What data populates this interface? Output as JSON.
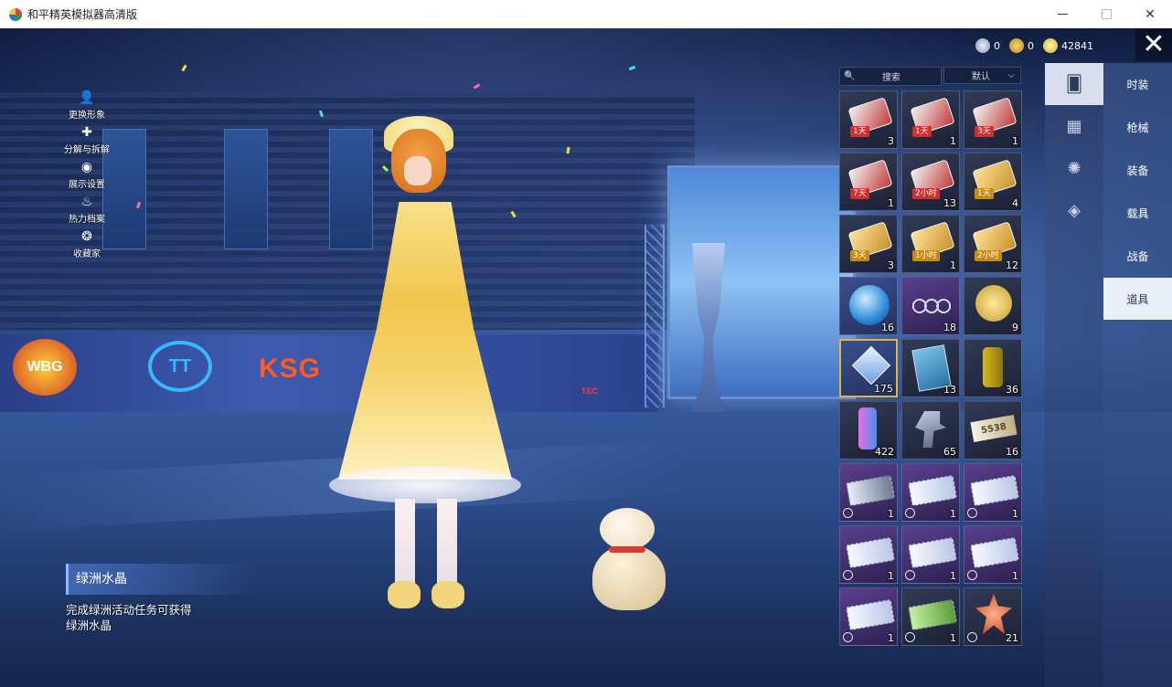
{
  "window": {
    "title": "和平精英模拟器高清版",
    "close_glyph": "✕",
    "max_glyph": "☐"
  },
  "currency": [
    {
      "icon": "silver-coin-icon",
      "value": "0"
    },
    {
      "icon": "gold-coin-icon",
      "value": "0"
    },
    {
      "icon": "bp-coin-icon",
      "value": "42841"
    }
  ],
  "close_glyph": "✕",
  "left_menu": [
    {
      "icon": "person-icon",
      "glyph": "👤",
      "label": "更换形象"
    },
    {
      "icon": "puzzle-icon",
      "glyph": "✚",
      "label": "分解与拆解"
    },
    {
      "icon": "eye-icon",
      "glyph": "◉",
      "label": "展示设置"
    },
    {
      "icon": "flame-icon",
      "glyph": "♨",
      "label": "热力档案"
    },
    {
      "icon": "collector-icon",
      "glyph": "❂",
      "label": "收藏家"
    }
  ],
  "logos": [
    "WBG",
    "TT",
    "KSG",
    "TEC"
  ],
  "item_detail": {
    "name": "绿洲水晶",
    "description": "完成绿洲活动任务可获得绿洲水晶"
  },
  "inventory": {
    "search_placeholder": "搜索",
    "search_icon_glyph": "🔍",
    "sort_label": "默认",
    "sort_arrow": "⌵",
    "items": [
      {
        "icon": "card-icon",
        "style": "red",
        "tier": "dark",
        "tag": "1天",
        "qty": "3",
        "clock": false
      },
      {
        "icon": "card-icon",
        "style": "red",
        "tier": "dark",
        "tag": "1天",
        "qty": "1",
        "clock": false
      },
      {
        "icon": "card-icon",
        "style": "red",
        "tier": "dark",
        "tag": "3天",
        "qty": "1",
        "clock": false
      },
      {
        "icon": "card-icon",
        "style": "red",
        "tier": "dark",
        "tag": "7天",
        "qty": "1",
        "clock": false
      },
      {
        "icon": "card-icon",
        "style": "red",
        "tier": "dark",
        "tag": "2小时",
        "qty": "13",
        "clock": false
      },
      {
        "icon": "card-icon",
        "style": "gold",
        "tier": "dark",
        "tag": "1天",
        "qty": "4",
        "clock": false
      },
      {
        "icon": "card-icon",
        "style": "gold",
        "tier": "dark",
        "tag": "3天",
        "qty": "3",
        "clock": false
      },
      {
        "icon": "card-icon",
        "style": "gold",
        "tier": "dark",
        "tag": "1小时",
        "qty": "1",
        "clock": false
      },
      {
        "icon": "card-icon",
        "style": "gold",
        "tier": "dark",
        "tag": "2小时",
        "qty": "12",
        "clock": false
      },
      {
        "icon": "orb-icon",
        "style": "",
        "tier": "blue",
        "tag": "",
        "qty": "16",
        "clock": false
      },
      {
        "icon": "rings-icon",
        "style": "",
        "tier": "purple",
        "tag": "",
        "qty": "18",
        "clock": false
      },
      {
        "icon": "puzzle-piece-icon",
        "style": "",
        "tier": "dark",
        "tag": "",
        "qty": "9",
        "clock": false
      },
      {
        "icon": "crystal-icon",
        "style": "",
        "tier": "blue",
        "tag": "",
        "qty": "175",
        "clock": false,
        "selected": true
      },
      {
        "icon": "book-icon",
        "style": "",
        "tier": "dark",
        "tag": "",
        "qty": "13",
        "clock": false
      },
      {
        "icon": "canister-icon",
        "style": "",
        "tier": "dark",
        "tag": "",
        "qty": "36",
        "clock": false
      },
      {
        "icon": "spray-can-icon",
        "style": "",
        "tier": "dark",
        "tag": "",
        "qty": "422",
        "clock": false
      },
      {
        "icon": "spray-gun-icon",
        "style": "",
        "tier": "dark",
        "tag": "",
        "qty": "65",
        "clock": false
      },
      {
        "icon": "ticket-icon",
        "style": "5538",
        "tier": "dark",
        "tag": "",
        "qty": "16",
        "clock": false
      },
      {
        "icon": "ticket-icon",
        "style": "dark",
        "tier": "purple",
        "tag": "",
        "qty": "1",
        "clock": true
      },
      {
        "icon": "ticket-icon",
        "style": "",
        "tier": "purple",
        "tag": "",
        "qty": "1",
        "clock": true
      },
      {
        "icon": "ticket-icon",
        "style": "",
        "tier": "purple",
        "tag": "",
        "qty": "1",
        "clock": true
      },
      {
        "icon": "ticket-icon",
        "style": "",
        "tier": "purple",
        "tag": "",
        "qty": "1",
        "clock": true
      },
      {
        "icon": "ticket-icon",
        "style": "",
        "tier": "purple",
        "tag": "",
        "qty": "1",
        "clock": true
      },
      {
        "icon": "ticket-icon",
        "style": "",
        "tier": "purple",
        "tag": "",
        "qty": "1",
        "clock": true
      },
      {
        "icon": "ticket-icon",
        "style": "",
        "tier": "purple",
        "tag": "",
        "qty": "1",
        "clock": true
      },
      {
        "icon": "ticket-icon",
        "style": "green",
        "tier": "dark",
        "tag": "",
        "qty": "1",
        "clock": true
      },
      {
        "icon": "medal-icon",
        "style": "",
        "tier": "dark",
        "tag": "",
        "qty": "21",
        "clock": true
      }
    ]
  },
  "side_icons": [
    {
      "icon": "outfit-card-icon",
      "glyph": "🂠",
      "active": true
    },
    {
      "icon": "calendar-icon",
      "glyph": "▦",
      "active": false
    },
    {
      "icon": "burst-icon",
      "glyph": "✺",
      "active": false
    },
    {
      "icon": "tag-icon",
      "glyph": "◈",
      "active": false
    }
  ],
  "categories": [
    {
      "label": "时装",
      "active": false
    },
    {
      "label": "枪械",
      "active": false
    },
    {
      "label": "装备",
      "active": false
    },
    {
      "label": "载具",
      "active": false
    },
    {
      "label": "战备",
      "active": false
    },
    {
      "label": "道具",
      "active": true
    }
  ],
  "colors": {
    "accent": "#e3b33a",
    "panel": "#e9eef7",
    "title_bg": "#ffffff"
  }
}
